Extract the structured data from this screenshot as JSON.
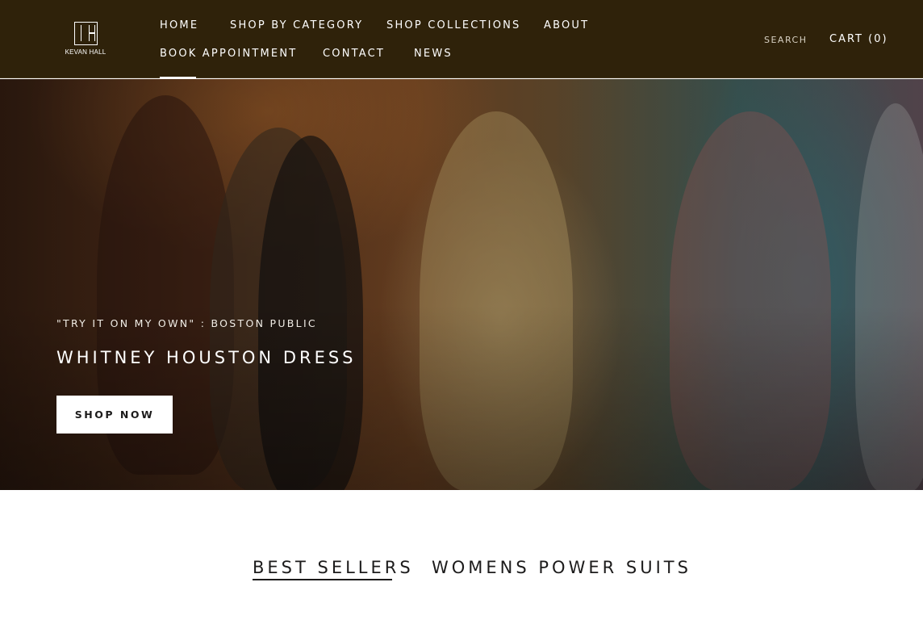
{
  "brand": {
    "logo_text": "KEVAN HALL"
  },
  "nav": {
    "home": "HOME",
    "shop_by_category": "SHOP BY CATEGORY",
    "shop_collections": "SHOP COLLECTIONS",
    "about": "ABOUT",
    "book_appointment": "BOOK APPOINTMENT",
    "contact": "CONTACT",
    "news": "NEWS"
  },
  "header": {
    "search": "SEARCH",
    "cart": "CART (0)"
  },
  "hero": {
    "subtitle": "\"TRY IT ON MY OWN\" : BOSTON PUBLIC",
    "title": "WHITNEY HOUSTON DRESS",
    "cta": "SHOP NOW"
  },
  "tabs": [
    {
      "label": "BEST SELLERS",
      "active": true
    },
    {
      "label": "WOMENS POWER SUITS",
      "active": false
    }
  ],
  "colors": {
    "header_bg": "#2f220a",
    "text_dark": "#1c1b1b",
    "white": "#ffffff"
  }
}
